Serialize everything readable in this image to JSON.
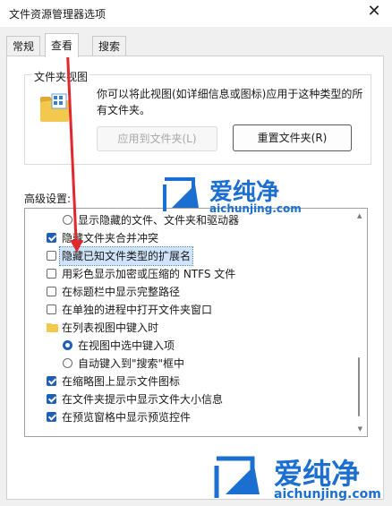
{
  "window": {
    "title": "文件资源管理器选项"
  },
  "tabs": [
    {
      "label": "常规"
    },
    {
      "label": "查看",
      "active": true
    },
    {
      "label": "搜索"
    }
  ],
  "folder_views": {
    "group_label": "文件夹视图",
    "description": "你可以将此视图(如详细信息或图标)应用于这种类型的所有文件夹。",
    "apply_button": "应用到文件夹(L)",
    "reset_button": "重置文件夹(R)"
  },
  "advanced": {
    "label": "高级设置:",
    "items": [
      {
        "type": "radio",
        "label": "显示隐藏的文件、文件夹和驱动器",
        "checked": false
      },
      {
        "type": "checkbox",
        "label": "隐藏文件夹合并冲突",
        "checked": true
      },
      {
        "type": "checkbox",
        "label": "隐藏已知文件类型的扩展名",
        "checked": false,
        "highlighted": true
      },
      {
        "type": "checkbox",
        "label": "用彩色显示加密或压缩的 NTFS 文件",
        "checked": false
      },
      {
        "type": "checkbox",
        "label": "在标题栏中显示完整路径",
        "checked": false
      },
      {
        "type": "checkbox",
        "label": "在单独的进程中打开文件夹窗口",
        "checked": false
      },
      {
        "type": "folder",
        "label": "在列表视图中键入时"
      },
      {
        "type": "radio",
        "label": "在视图中选中键入项",
        "checked": true
      },
      {
        "type": "radio",
        "label": "自动键入到\"搜索\"框中",
        "checked": false
      },
      {
        "type": "checkbox",
        "label": "在缩略图上显示文件图标",
        "checked": true
      },
      {
        "type": "checkbox",
        "label": "在文件夹提示中显示文件大小信息",
        "checked": true
      },
      {
        "type": "checkbox",
        "label": "在预览窗格中显示预览控件",
        "checked": true
      }
    ]
  },
  "watermark": {
    "brand": "爱纯净",
    "domain": "aichunjing.com"
  },
  "colors": {
    "accent": "#1f5fb8",
    "arrow": "#e0282e",
    "watermark": "#1a6fd1"
  }
}
